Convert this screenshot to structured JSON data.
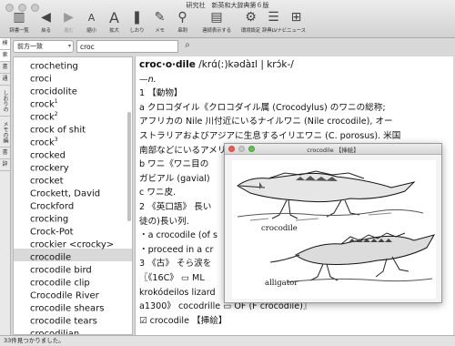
{
  "window": {
    "title": "研究社　新英和大辞典第６版"
  },
  "toolbar": {
    "items": [
      {
        "label": "辞書一覧",
        "icon": "books-icon"
      },
      {
        "label": "戻る",
        "icon": "back-icon"
      },
      {
        "label": "進む",
        "icon": "forward-icon"
      },
      {
        "label": "縮小",
        "icon": "font-smaller-icon"
      },
      {
        "label": "拡大",
        "icon": "font-larger-icon"
      },
      {
        "label": "しおり",
        "icon": "bookmark-icon"
      },
      {
        "label": "メモ",
        "icon": "memo-icon"
      },
      {
        "label": "串刺",
        "icon": "multi-search-icon"
      },
      {
        "label": "連続表示する",
        "icon": "continuous-view-icon"
      },
      {
        "label": "環境設定",
        "icon": "gear-icon"
      },
      {
        "label": "辞典LVナビ",
        "icon": "navi-icon"
      },
      {
        "label": "ニュース",
        "icon": "news-icon"
      }
    ]
  },
  "sidebar_tabs": [
    {
      "label": "検"
    },
    {
      "label": "索"
    },
    {
      "label": "書"
    },
    {
      "label": "通"
    },
    {
      "label": "しおりの編集"
    },
    {
      "label": "メモの編集"
    },
    {
      "label": "書"
    },
    {
      "label": "辞"
    }
  ],
  "search": {
    "mode": "前方一致",
    "query": "croc"
  },
  "wordlist": [
    {
      "word": "crocheting",
      "sup": ""
    },
    {
      "word": "croci",
      "sup": ""
    },
    {
      "word": "crocidolite",
      "sup": ""
    },
    {
      "word": "crock",
      "sup": "1"
    },
    {
      "word": "crock",
      "sup": "2"
    },
    {
      "word": "crock of shit",
      "sup": ""
    },
    {
      "word": "crock",
      "sup": "3"
    },
    {
      "word": "crocked",
      "sup": ""
    },
    {
      "word": "crockery",
      "sup": ""
    },
    {
      "word": "crocket",
      "sup": ""
    },
    {
      "word": "Crockett, David",
      "sup": ""
    },
    {
      "word": "Crockford",
      "sup": ""
    },
    {
      "word": "crocking",
      "sup": ""
    },
    {
      "word": "Crock-Pot",
      "sup": ""
    },
    {
      "word": "crockier <crocky>",
      "sup": ""
    },
    {
      "word": "crocodile",
      "sup": "",
      "selected": true
    },
    {
      "word": "crocodile bird",
      "sup": ""
    },
    {
      "word": "crocodile clip",
      "sup": ""
    },
    {
      "word": "Crocodile River",
      "sup": ""
    },
    {
      "word": "crocodile shears",
      "sup": ""
    },
    {
      "word": "crocodile tears",
      "sup": ""
    },
    {
      "word": "crocodilian",
      "sup": ""
    }
  ],
  "definition": {
    "headword": "croc·o·dile",
    "pron": " /krɑ́(ː)kədàɪl | krɔ́k-/",
    "pos": "—n.",
    "lines": [
      "1 【動物】",
      "a クロコダイル《クロコダイル属 (Crocodylus) のワニの総称;",
      "アフリカの Nile 川付近にいるナイルワニ (Nile crocodile), オー",
      "ストラリアおよびアジアに生息するイリエワニ (C. porosus). 米国",
      "南部などにいるアメリカワニ",
      "b ワニ《ワニ目の",
      "ガビアル (gavial)",
      "c ワニ皮.",
      "2 《英口語》 長い",
      "徒の)長い列.",
      "・a crocodile (of s",
      "・proceed in a cr",
      "3 《古》 そら涙を",
      "〖《16C》 ▭ ML",
      "krokódeilos lizard",
      "a1300》 cocodrille ▭ OF (F crocodile)〗",
      "☑ crocodile 【挿絵】"
    ]
  },
  "popup": {
    "title": "crocodile 【挿絵】",
    "caption_top": "crocodile",
    "caption_bottom": "alligator"
  },
  "status": {
    "text": "33件見つかりました。"
  }
}
